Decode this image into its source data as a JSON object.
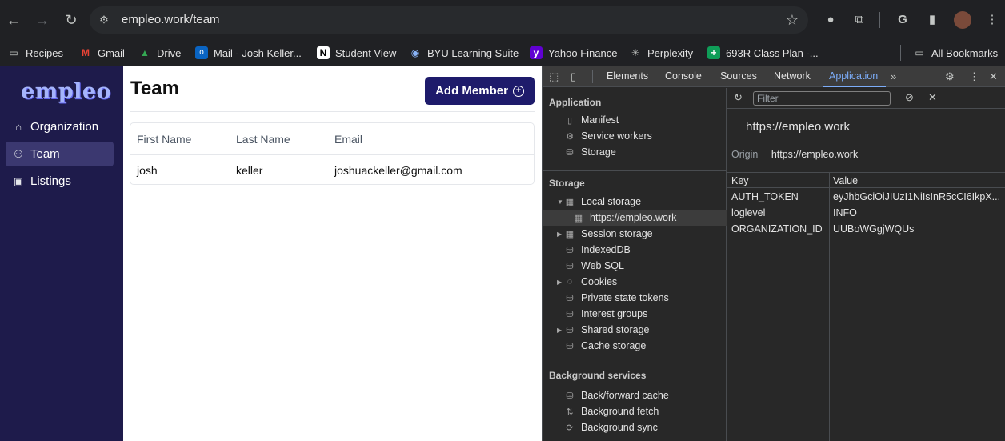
{
  "browser": {
    "url": "empleo.work/team",
    "bookmarks": [
      "Recipes",
      "Gmail",
      "Drive",
      "Mail - Josh Keller...",
      "Student View",
      "BYU Learning Suite",
      "Yahoo Finance",
      "Perplexity",
      "693R Class Plan -...",
      "All Bookmarks"
    ]
  },
  "app": {
    "logo": "empleo",
    "nav": [
      {
        "label": "Organization",
        "icon": "home-icon"
      },
      {
        "label": "Team",
        "icon": "user-icon"
      },
      {
        "label": "Listings",
        "icon": "briefcase-icon"
      }
    ],
    "title": "Team",
    "add_button": "Add Member",
    "table": {
      "headers": [
        "First Name",
        "Last Name",
        "Email"
      ],
      "rows": [
        [
          "josh",
          "keller",
          "joshuackeller@gmail.com"
        ]
      ]
    }
  },
  "devtools": {
    "tabs": [
      "Elements",
      "Console",
      "Sources",
      "Network",
      "Application"
    ],
    "active_tab": "Application",
    "sections": {
      "application": "Application",
      "application_items": [
        "Manifest",
        "Service workers",
        "Storage"
      ],
      "storage": "Storage",
      "storage_items": [
        "Local storage",
        "https://empleo.work",
        "Session storage",
        "IndexedDB",
        "Web SQL",
        "Cookies",
        "Private state tokens",
        "Interest groups",
        "Shared storage",
        "Cache storage"
      ],
      "background": "Background services",
      "background_items": [
        "Back/forward cache",
        "Background fetch",
        "Background sync"
      ]
    },
    "filter_placeholder": "Filter",
    "origin_title": "https://empleo.work",
    "origin_label": "Origin",
    "origin_value": "https://empleo.work",
    "kv_headers": [
      "Key",
      "Value"
    ],
    "kv_rows": [
      [
        "AUTH_TOKEN",
        "eyJhbGciOiJIUzI1NiIsInR5cCI6IkpX..."
      ],
      [
        "loglevel",
        "INFO"
      ],
      [
        "ORGANIZATION_ID",
        "UUBoWGgjWQUs"
      ]
    ],
    "accent_color": "#7cacf8"
  }
}
